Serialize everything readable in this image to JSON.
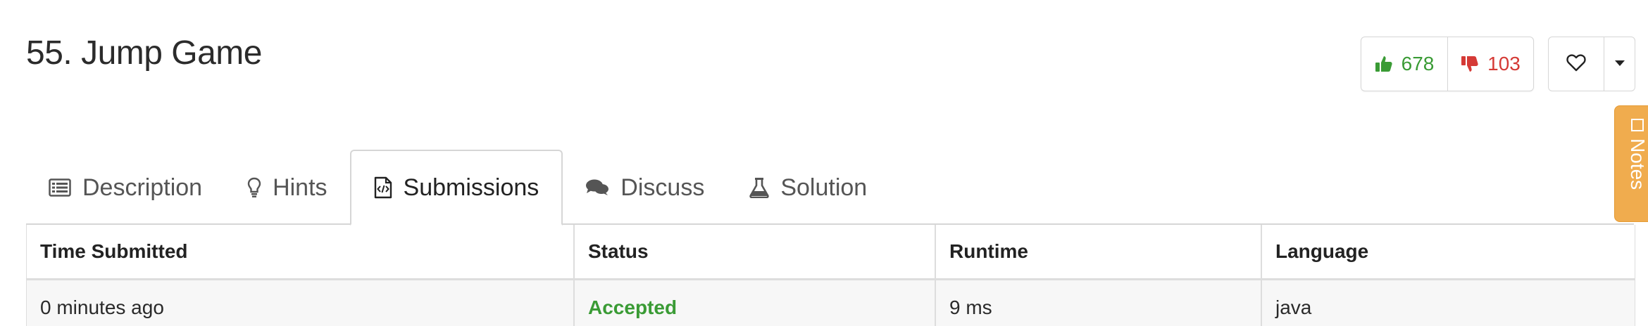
{
  "problem": {
    "title": "55. Jump Game"
  },
  "votes": {
    "likes": "678",
    "dislikes": "103"
  },
  "notes": {
    "label": "Notes"
  },
  "tabs": [
    {
      "label": "Description",
      "icon": "list-icon",
      "active": false
    },
    {
      "label": "Hints",
      "icon": "lightbulb-icon",
      "active": false
    },
    {
      "label": "Submissions",
      "icon": "code-file-icon",
      "active": true
    },
    {
      "label": "Discuss",
      "icon": "comments-icon",
      "active": false
    },
    {
      "label": "Solution",
      "icon": "flask-icon",
      "active": false
    }
  ],
  "table": {
    "columns": [
      "Time Submitted",
      "Status",
      "Runtime",
      "Language"
    ],
    "rows": [
      [
        "0 minutes ago",
        "Accepted",
        "9 ms",
        "java"
      ]
    ]
  },
  "colors": {
    "accent_green": "#3a9b35",
    "accent_red": "#d53a36",
    "notes_orange": "#f0ac4e"
  }
}
